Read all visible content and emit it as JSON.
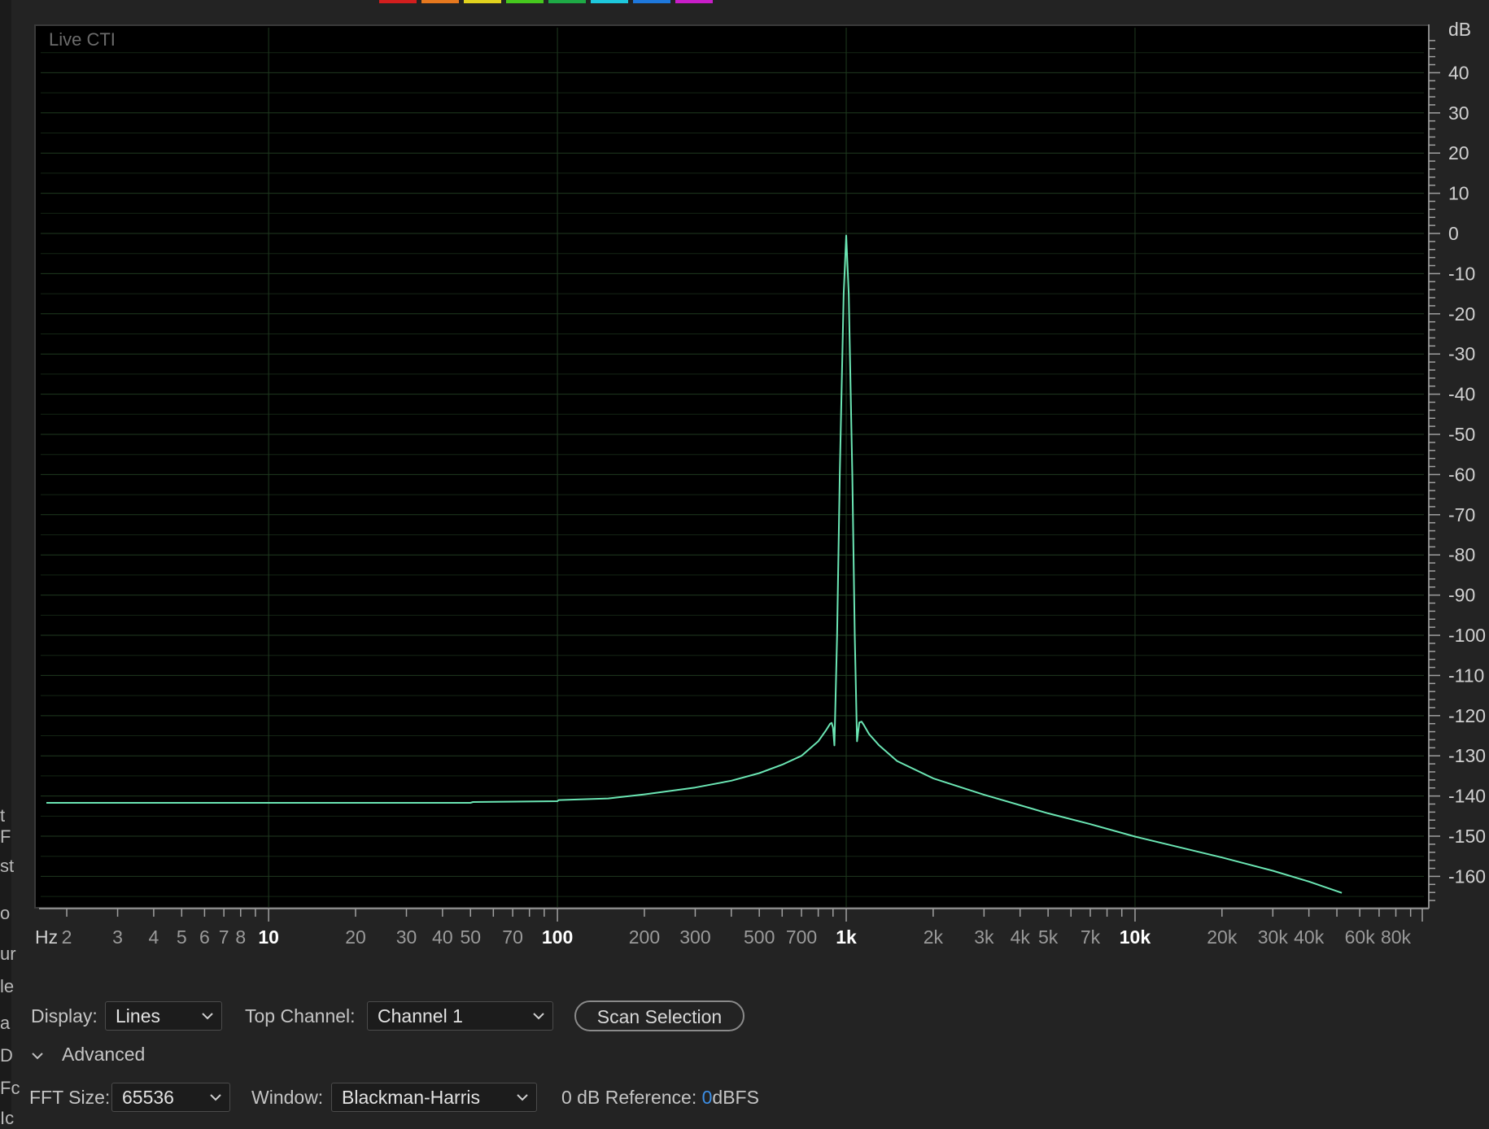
{
  "swatch_colors": [
    "#d21e1e",
    "#e6781e",
    "#e1d21e",
    "#46c81e",
    "#1eaa46",
    "#1ec8dc",
    "#1e78dc",
    "#c81ec8"
  ],
  "left_strip_fragments": [
    "",
    "t F",
    "st",
    "o",
    "ur",
    "le",
    "a",
    "D",
    "Fc",
    "Ic"
  ],
  "plot": {
    "live_label": "Live CTI",
    "line_color": "#6be6b4",
    "grid_color": "#1f3a1f"
  },
  "chart_data": {
    "type": "line",
    "title": "",
    "xscale": "log",
    "xlim": [
      1.7,
      95000
    ],
    "ylim": [
      -167,
      50
    ],
    "xlabel": "Hz",
    "ylabel": "dB",
    "y_unit_label": "dB",
    "x_unit_label": "Hz",
    "x_ticks": [
      {
        "value": 2,
        "label": "2"
      },
      {
        "value": 3,
        "label": "3"
      },
      {
        "value": 4,
        "label": "4"
      },
      {
        "value": 5,
        "label": "5"
      },
      {
        "value": 6,
        "label": "6"
      },
      {
        "value": 7,
        "label": "7"
      },
      {
        "value": 8,
        "label": "8"
      },
      {
        "value": 10,
        "label": "10"
      },
      {
        "value": 20,
        "label": "20"
      },
      {
        "value": 30,
        "label": "30"
      },
      {
        "value": 40,
        "label": "40"
      },
      {
        "value": 50,
        "label": "50"
      },
      {
        "value": 70,
        "label": "70"
      },
      {
        "value": 100,
        "label": "100"
      },
      {
        "value": 200,
        "label": "200"
      },
      {
        "value": 300,
        "label": "300"
      },
      {
        "value": 500,
        "label": "500"
      },
      {
        "value": 700,
        "label": "700"
      },
      {
        "value": 1000,
        "label": "1k"
      },
      {
        "value": 2000,
        "label": "2k"
      },
      {
        "value": 3000,
        "label": "3k"
      },
      {
        "value": 4000,
        "label": "4k"
      },
      {
        "value": 5000,
        "label": "5k"
      },
      {
        "value": 7000,
        "label": "7k"
      },
      {
        "value": 10000,
        "label": "10k"
      },
      {
        "value": 20000,
        "label": "20k"
      },
      {
        "value": 30000,
        "label": "30k"
      },
      {
        "value": 40000,
        "label": "40k"
      },
      {
        "value": 60000,
        "label": "60k"
      },
      {
        "value": 80000,
        "label": "80k"
      }
    ],
    "bold_x_ticks": [
      10,
      100,
      1000,
      10000
    ],
    "y_ticks": [
      {
        "value": 40,
        "label": "40"
      },
      {
        "value": 30,
        "label": "30"
      },
      {
        "value": 20,
        "label": "20"
      },
      {
        "value": 10,
        "label": "10"
      },
      {
        "value": 0,
        "label": "0"
      },
      {
        "value": -10,
        "label": "-10"
      },
      {
        "value": -20,
        "label": "-20"
      },
      {
        "value": -30,
        "label": "-30"
      },
      {
        "value": -40,
        "label": "-40"
      },
      {
        "value": -50,
        "label": "-50"
      },
      {
        "value": -60,
        "label": "-60"
      },
      {
        "value": -70,
        "label": "-70"
      },
      {
        "value": -80,
        "label": "-80"
      },
      {
        "value": -90,
        "label": "-90"
      },
      {
        "value": -100,
        "label": "-100"
      },
      {
        "value": -110,
        "label": "-110"
      },
      {
        "value": -120,
        "label": "-120"
      },
      {
        "value": -130,
        "label": "-130"
      },
      {
        "value": -140,
        "label": "-140"
      },
      {
        "value": -150,
        "label": "-150"
      },
      {
        "value": -160,
        "label": "-160"
      }
    ],
    "series": [
      {
        "x": [
          1.7,
          10,
          50,
          51,
          100,
          101,
          150,
          200,
          300,
          400,
          500,
          600,
          700,
          800,
          850,
          880,
          890,
          900,
          910,
          930,
          950,
          980,
          1000,
          1020,
          1050,
          1070,
          1090,
          1100,
          1110,
          1130,
          1150,
          1200,
          1300,
          1500,
          2000,
          3000,
          5000,
          7000,
          10000,
          20000,
          30000,
          40000,
          52000
        ],
        "y": [
          -141.7,
          -141.7,
          -141.7,
          -141.5,
          -141.3,
          -141.0,
          -140.6,
          -139.6,
          -137.9,
          -136.2,
          -134.3,
          -132.2,
          -130.0,
          -126.4,
          -123.7,
          -122.0,
          -121.8,
          -123.0,
          -127.4,
          -100,
          -60,
          -15,
          -0.5,
          -15,
          -60,
          -100,
          -126.4,
          -124,
          -121.7,
          -121.5,
          -122.3,
          -124.6,
          -127.4,
          -131.3,
          -135.6,
          -139.7,
          -144.3,
          -147.0,
          -150.1,
          -155.3,
          -158.6,
          -161.3,
          -164.1
        ]
      }
    ]
  },
  "controls": {
    "display_label": "Display:",
    "display_value": "Lines",
    "top_channel_label": "Top Channel:",
    "top_channel_value": "Channel 1",
    "scan_button": "Scan Selection",
    "advanced_label": "Advanced",
    "fft_label": "FFT Size:",
    "fft_value": "65536",
    "window_label": "Window:",
    "window_value": "Blackman-Harris",
    "reference_label": "0 dB Reference:",
    "reference_value": "0",
    "reference_unit": "dBFS"
  }
}
